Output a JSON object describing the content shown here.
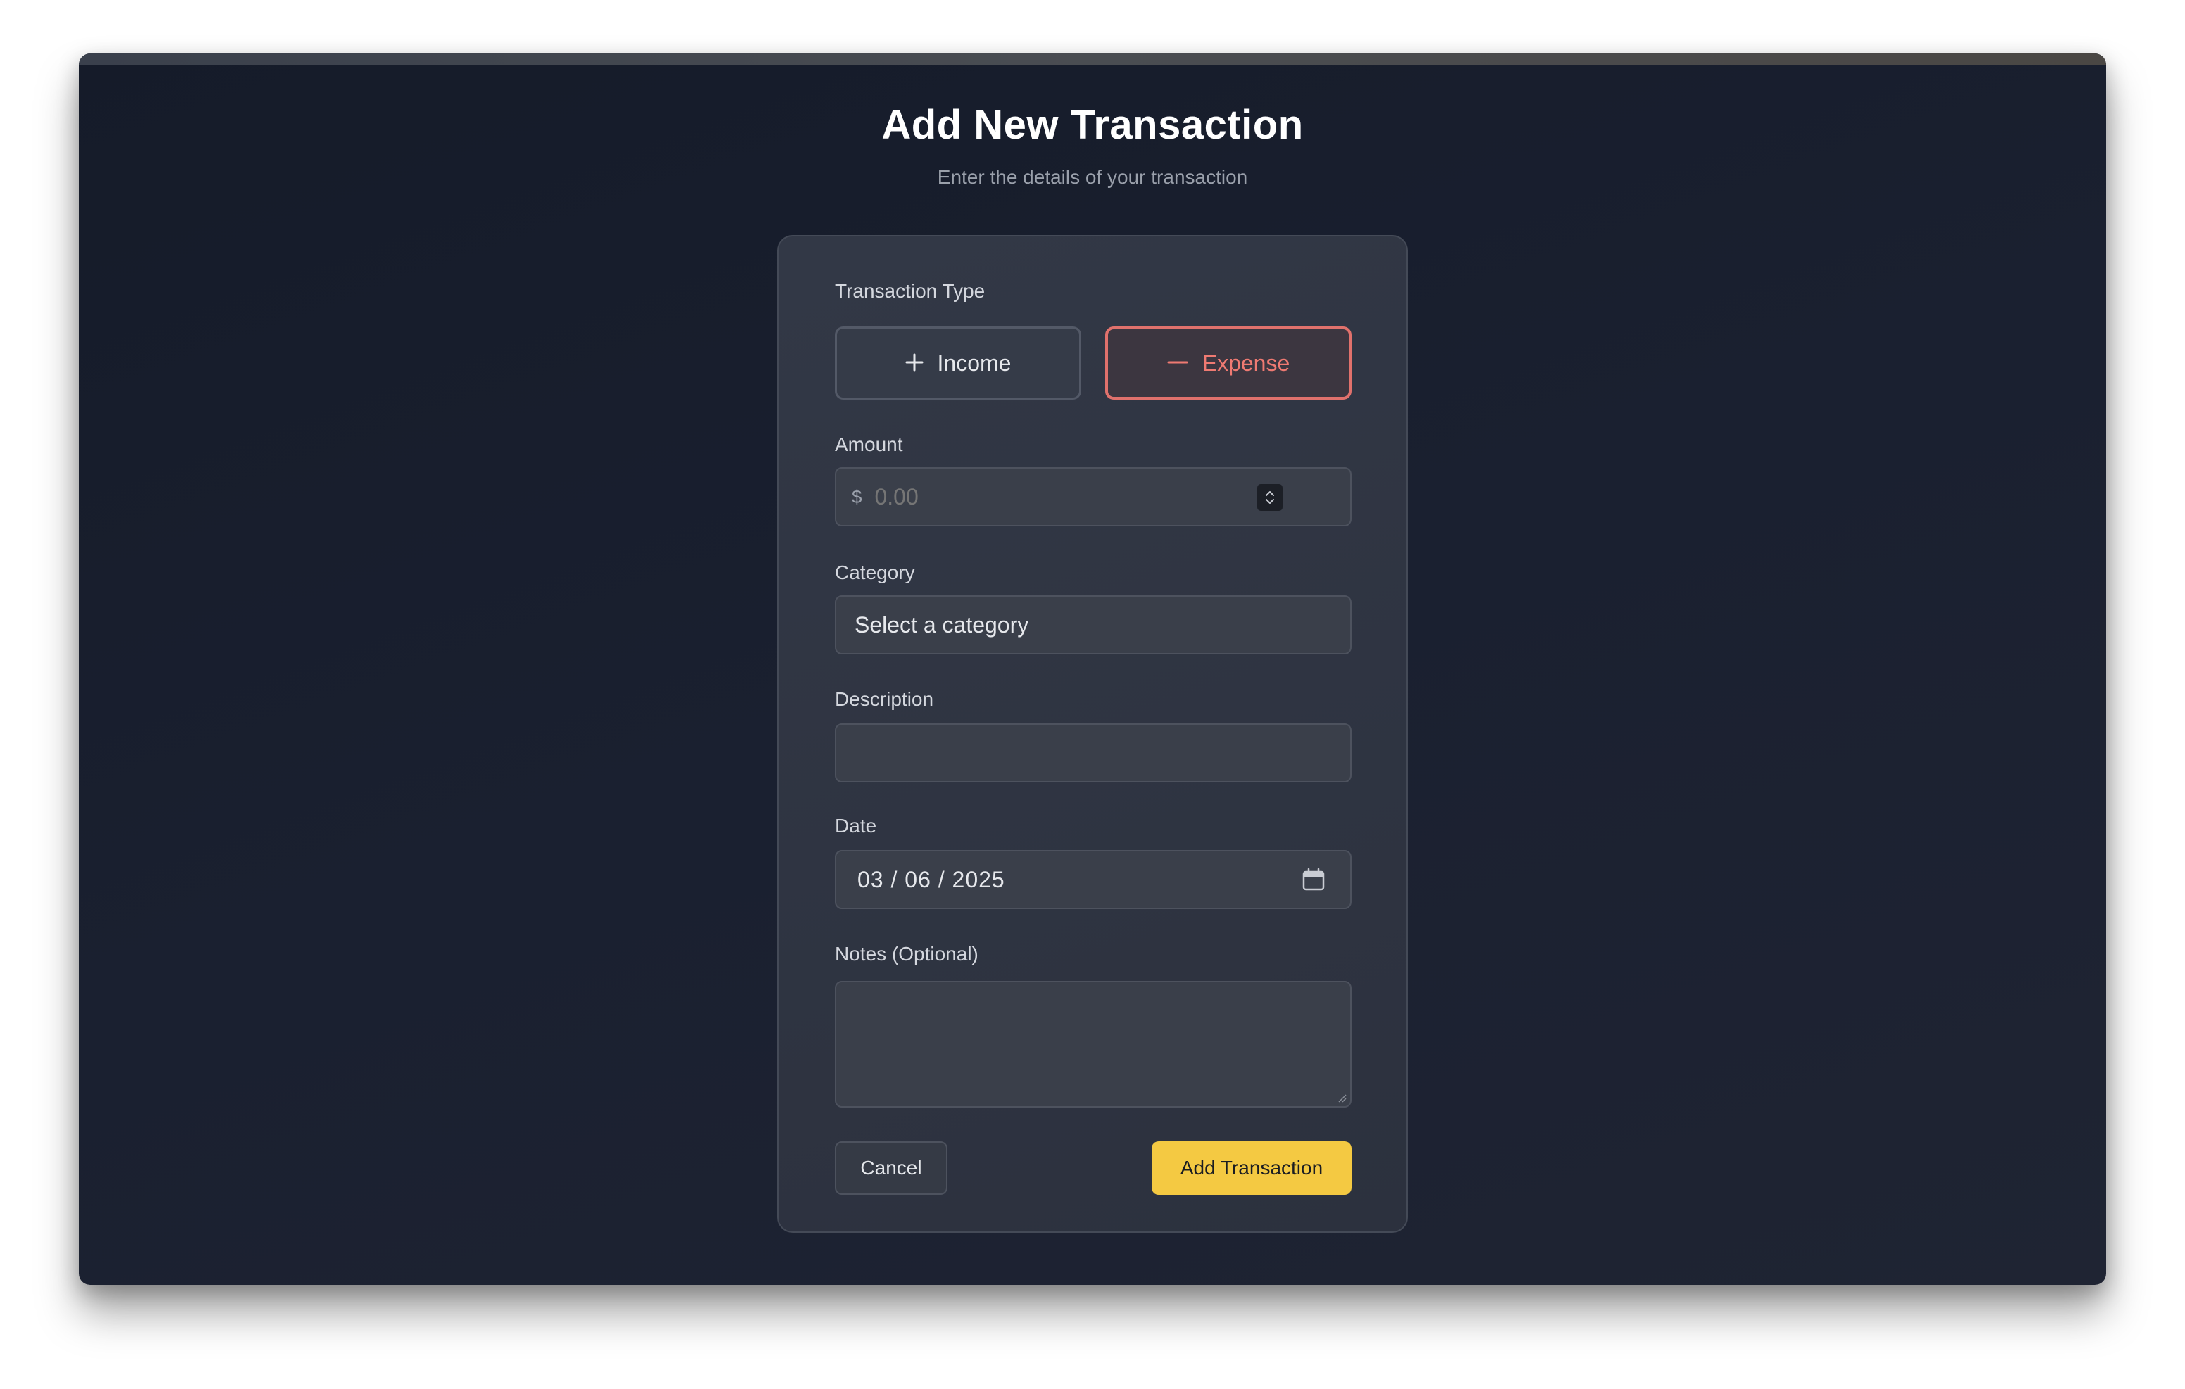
{
  "header": {
    "title": "Add New Transaction",
    "subtitle": "Enter the details of your transaction"
  },
  "form": {
    "type": {
      "label": "Transaction Type",
      "income_label": "Income",
      "expense_label": "Expense",
      "selected": "Expense",
      "income_icon": "plus-icon",
      "expense_icon": "minus-icon"
    },
    "amount": {
      "label": "Amount",
      "currency_symbol": "$",
      "placeholder": "0.00",
      "value": ""
    },
    "category": {
      "label": "Category",
      "selected": "Select a category"
    },
    "description": {
      "label": "Description",
      "value": ""
    },
    "date": {
      "label": "Date",
      "value": "03 / 06 / 2025",
      "icon": "calendar-icon"
    },
    "notes": {
      "label": "Notes (Optional)",
      "value": ""
    }
  },
  "actions": {
    "cancel_label": "Cancel",
    "submit_label": "Add Transaction"
  },
  "colors": {
    "accent": "#f4c942",
    "expense": "#e0716c",
    "background": "#1a2030",
    "card": "#2f3441"
  }
}
